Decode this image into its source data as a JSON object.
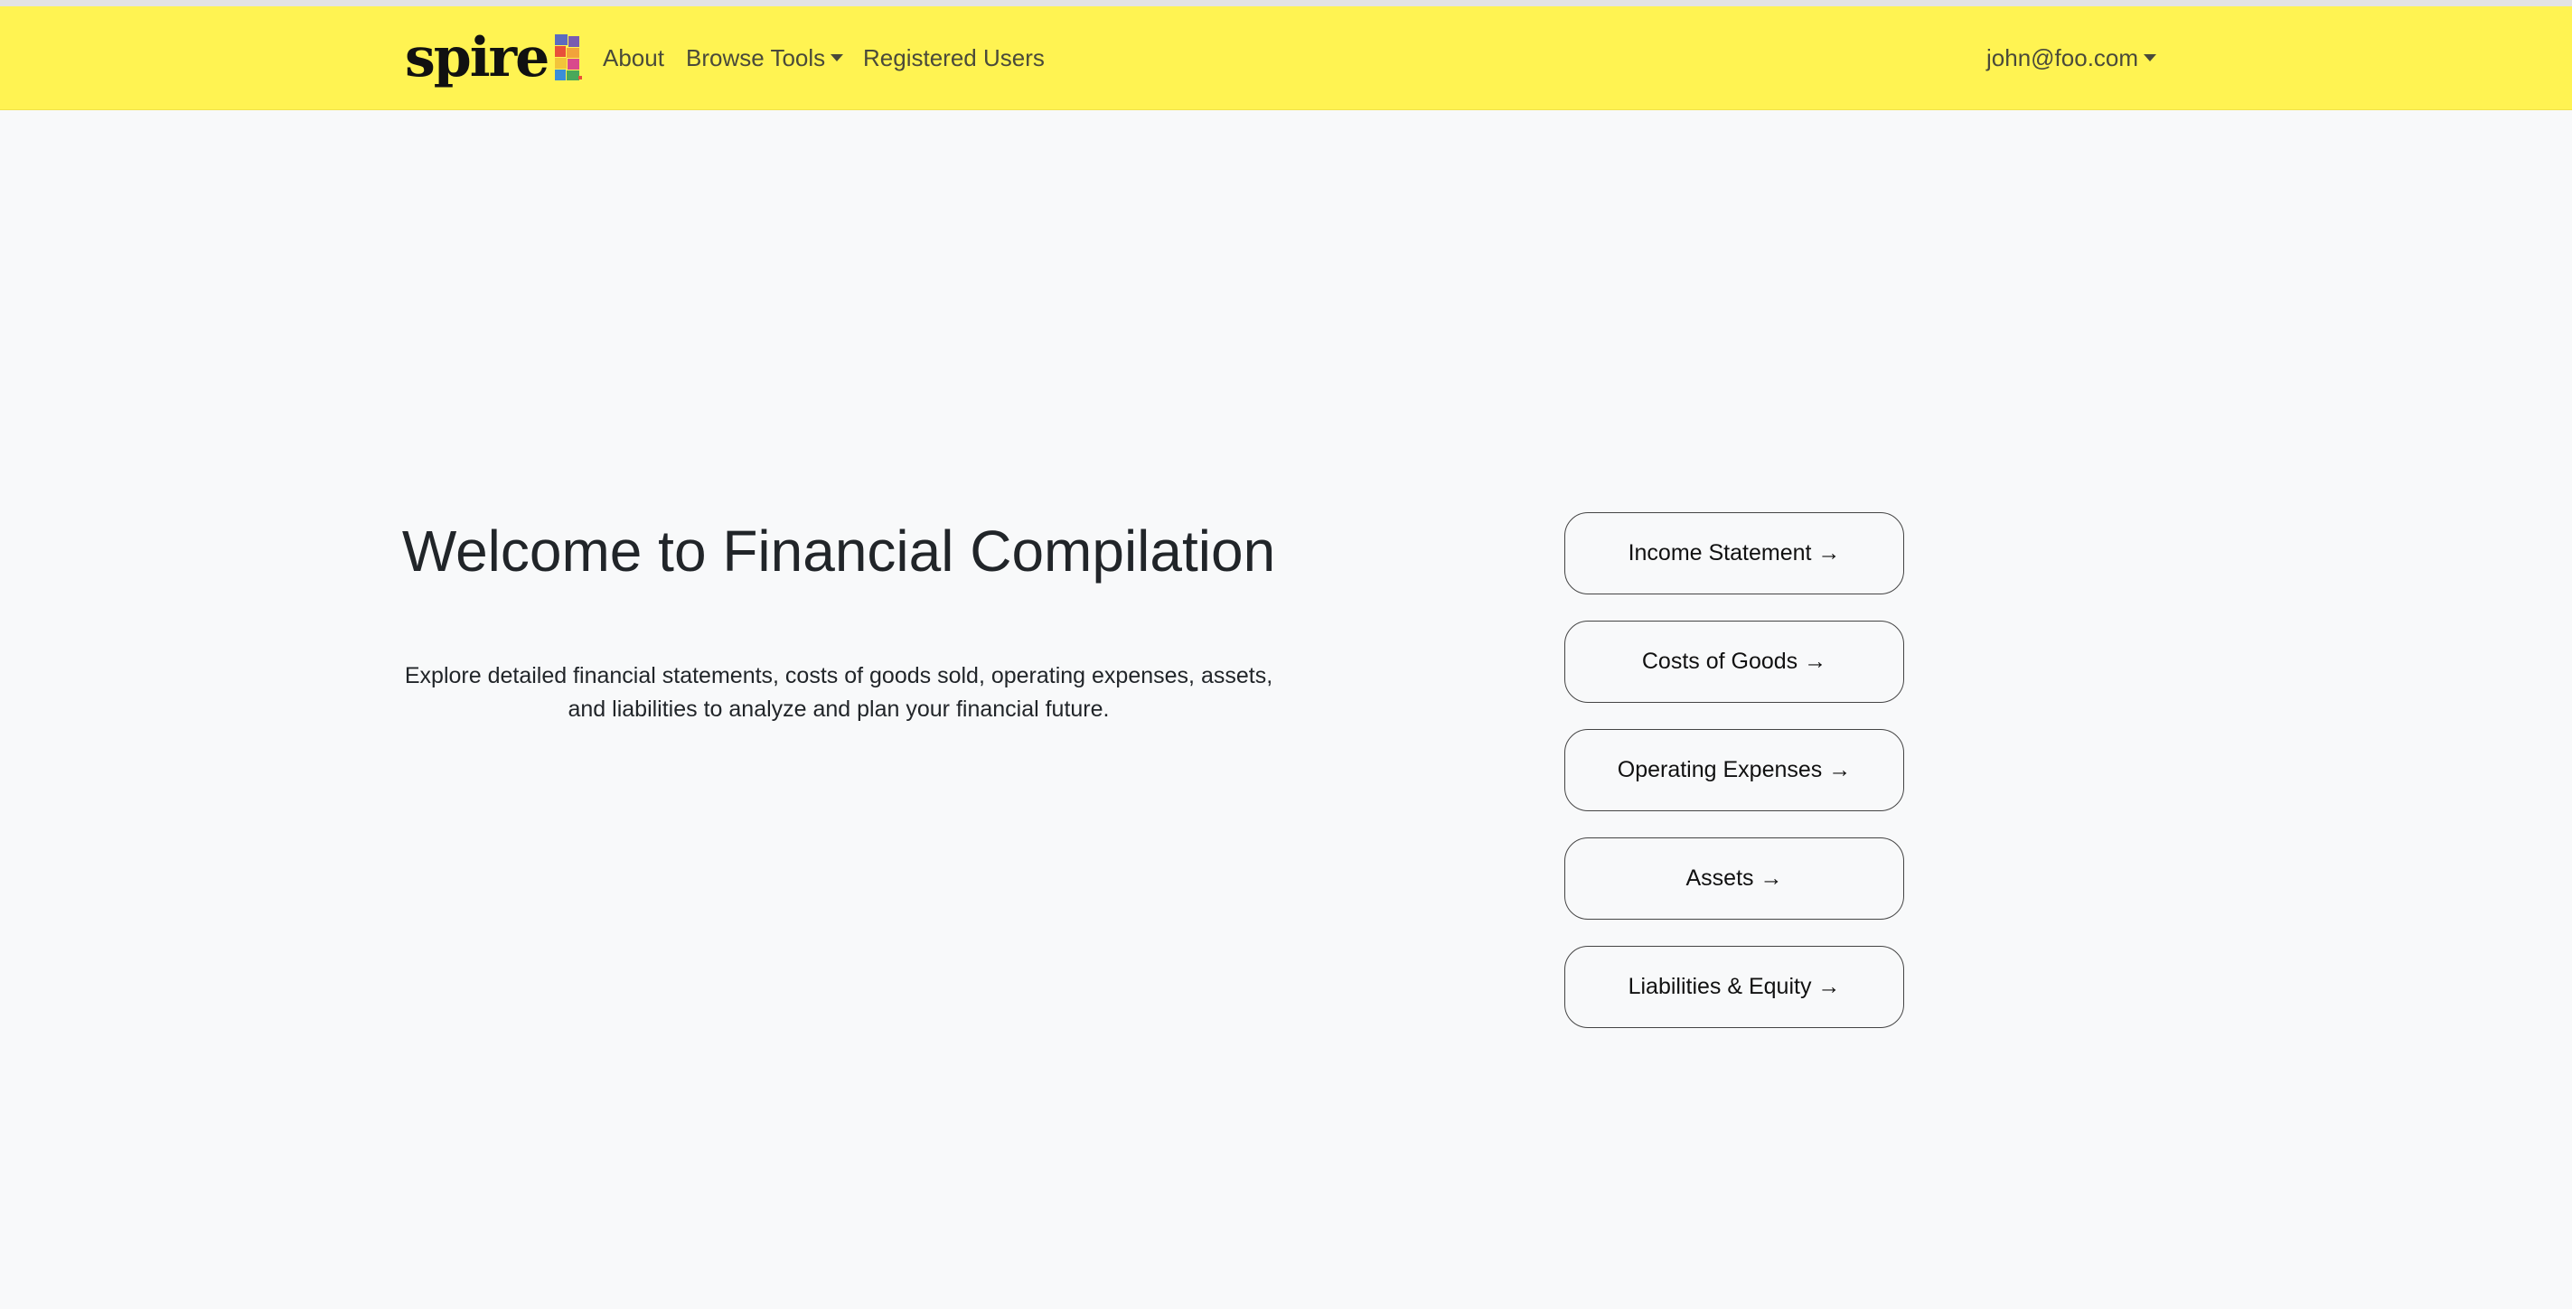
{
  "navbar": {
    "brand": "spire",
    "links": {
      "about": "About",
      "browse_tools": "Browse Tools",
      "registered_users": "Registered Users"
    },
    "user": "john@foo.com",
    "background": "#fff352"
  },
  "hero": {
    "title": "Welcome to Financial Compilation",
    "subtitle": "Explore detailed financial statements, costs of goods sold, operating expenses, assets, and liabilities to analyze and plan your financial future."
  },
  "buttons": [
    {
      "label": "Income Statement →"
    },
    {
      "label": "Costs of Goods →"
    },
    {
      "label": "Operating Expenses →"
    },
    {
      "label": "Assets →"
    },
    {
      "label": "Liabilities & Equity →"
    }
  ]
}
